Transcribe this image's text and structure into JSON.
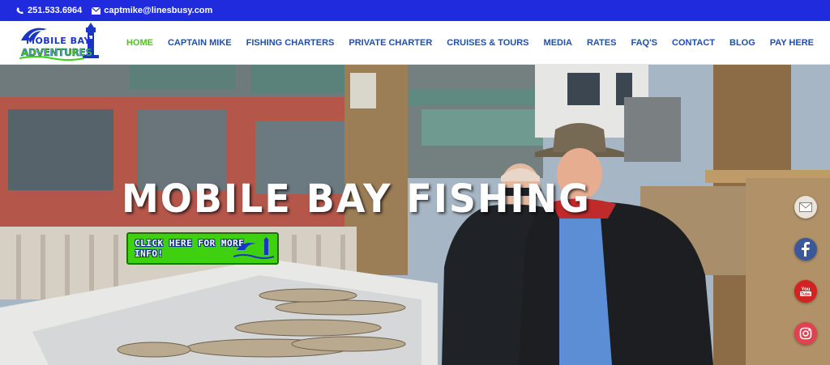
{
  "topbar": {
    "phone": "251.533.6964",
    "email": "captmike@linesbusy.com",
    "phone_icon": "phone-icon",
    "email_icon": "envelope-icon"
  },
  "logo": {
    "line1": "MOBILE BAY",
    "line2": "ADVENTURES"
  },
  "nav": {
    "items": [
      {
        "label": "HOME",
        "active": true
      },
      {
        "label": "CAPTAIN MIKE"
      },
      {
        "label": "FISHING CHARTERS"
      },
      {
        "label": "PRIVATE CHARTER"
      },
      {
        "label": "CRUISES & TOURS"
      },
      {
        "label": "MEDIA"
      },
      {
        "label": "RATES"
      },
      {
        "label": "FAQ'S"
      },
      {
        "label": "CONTACT"
      },
      {
        "label": "BLOG"
      },
      {
        "label": "PAY HERE"
      }
    ]
  },
  "hero": {
    "title": "MOBILE BAY FISHING",
    "cta_label": "CLICK HERE FOR MORE INFO!"
  },
  "social": {
    "icons": [
      "envelope-icon",
      "facebook-icon",
      "youtube-icon",
      "instagram-icon"
    ],
    "youtube_text": "You Tube"
  },
  "colors": {
    "topbar": "#1f2bdc",
    "nav_text": "#1f4fb0",
    "nav_active": "#4fc21c",
    "cta": "#3fd10f"
  }
}
